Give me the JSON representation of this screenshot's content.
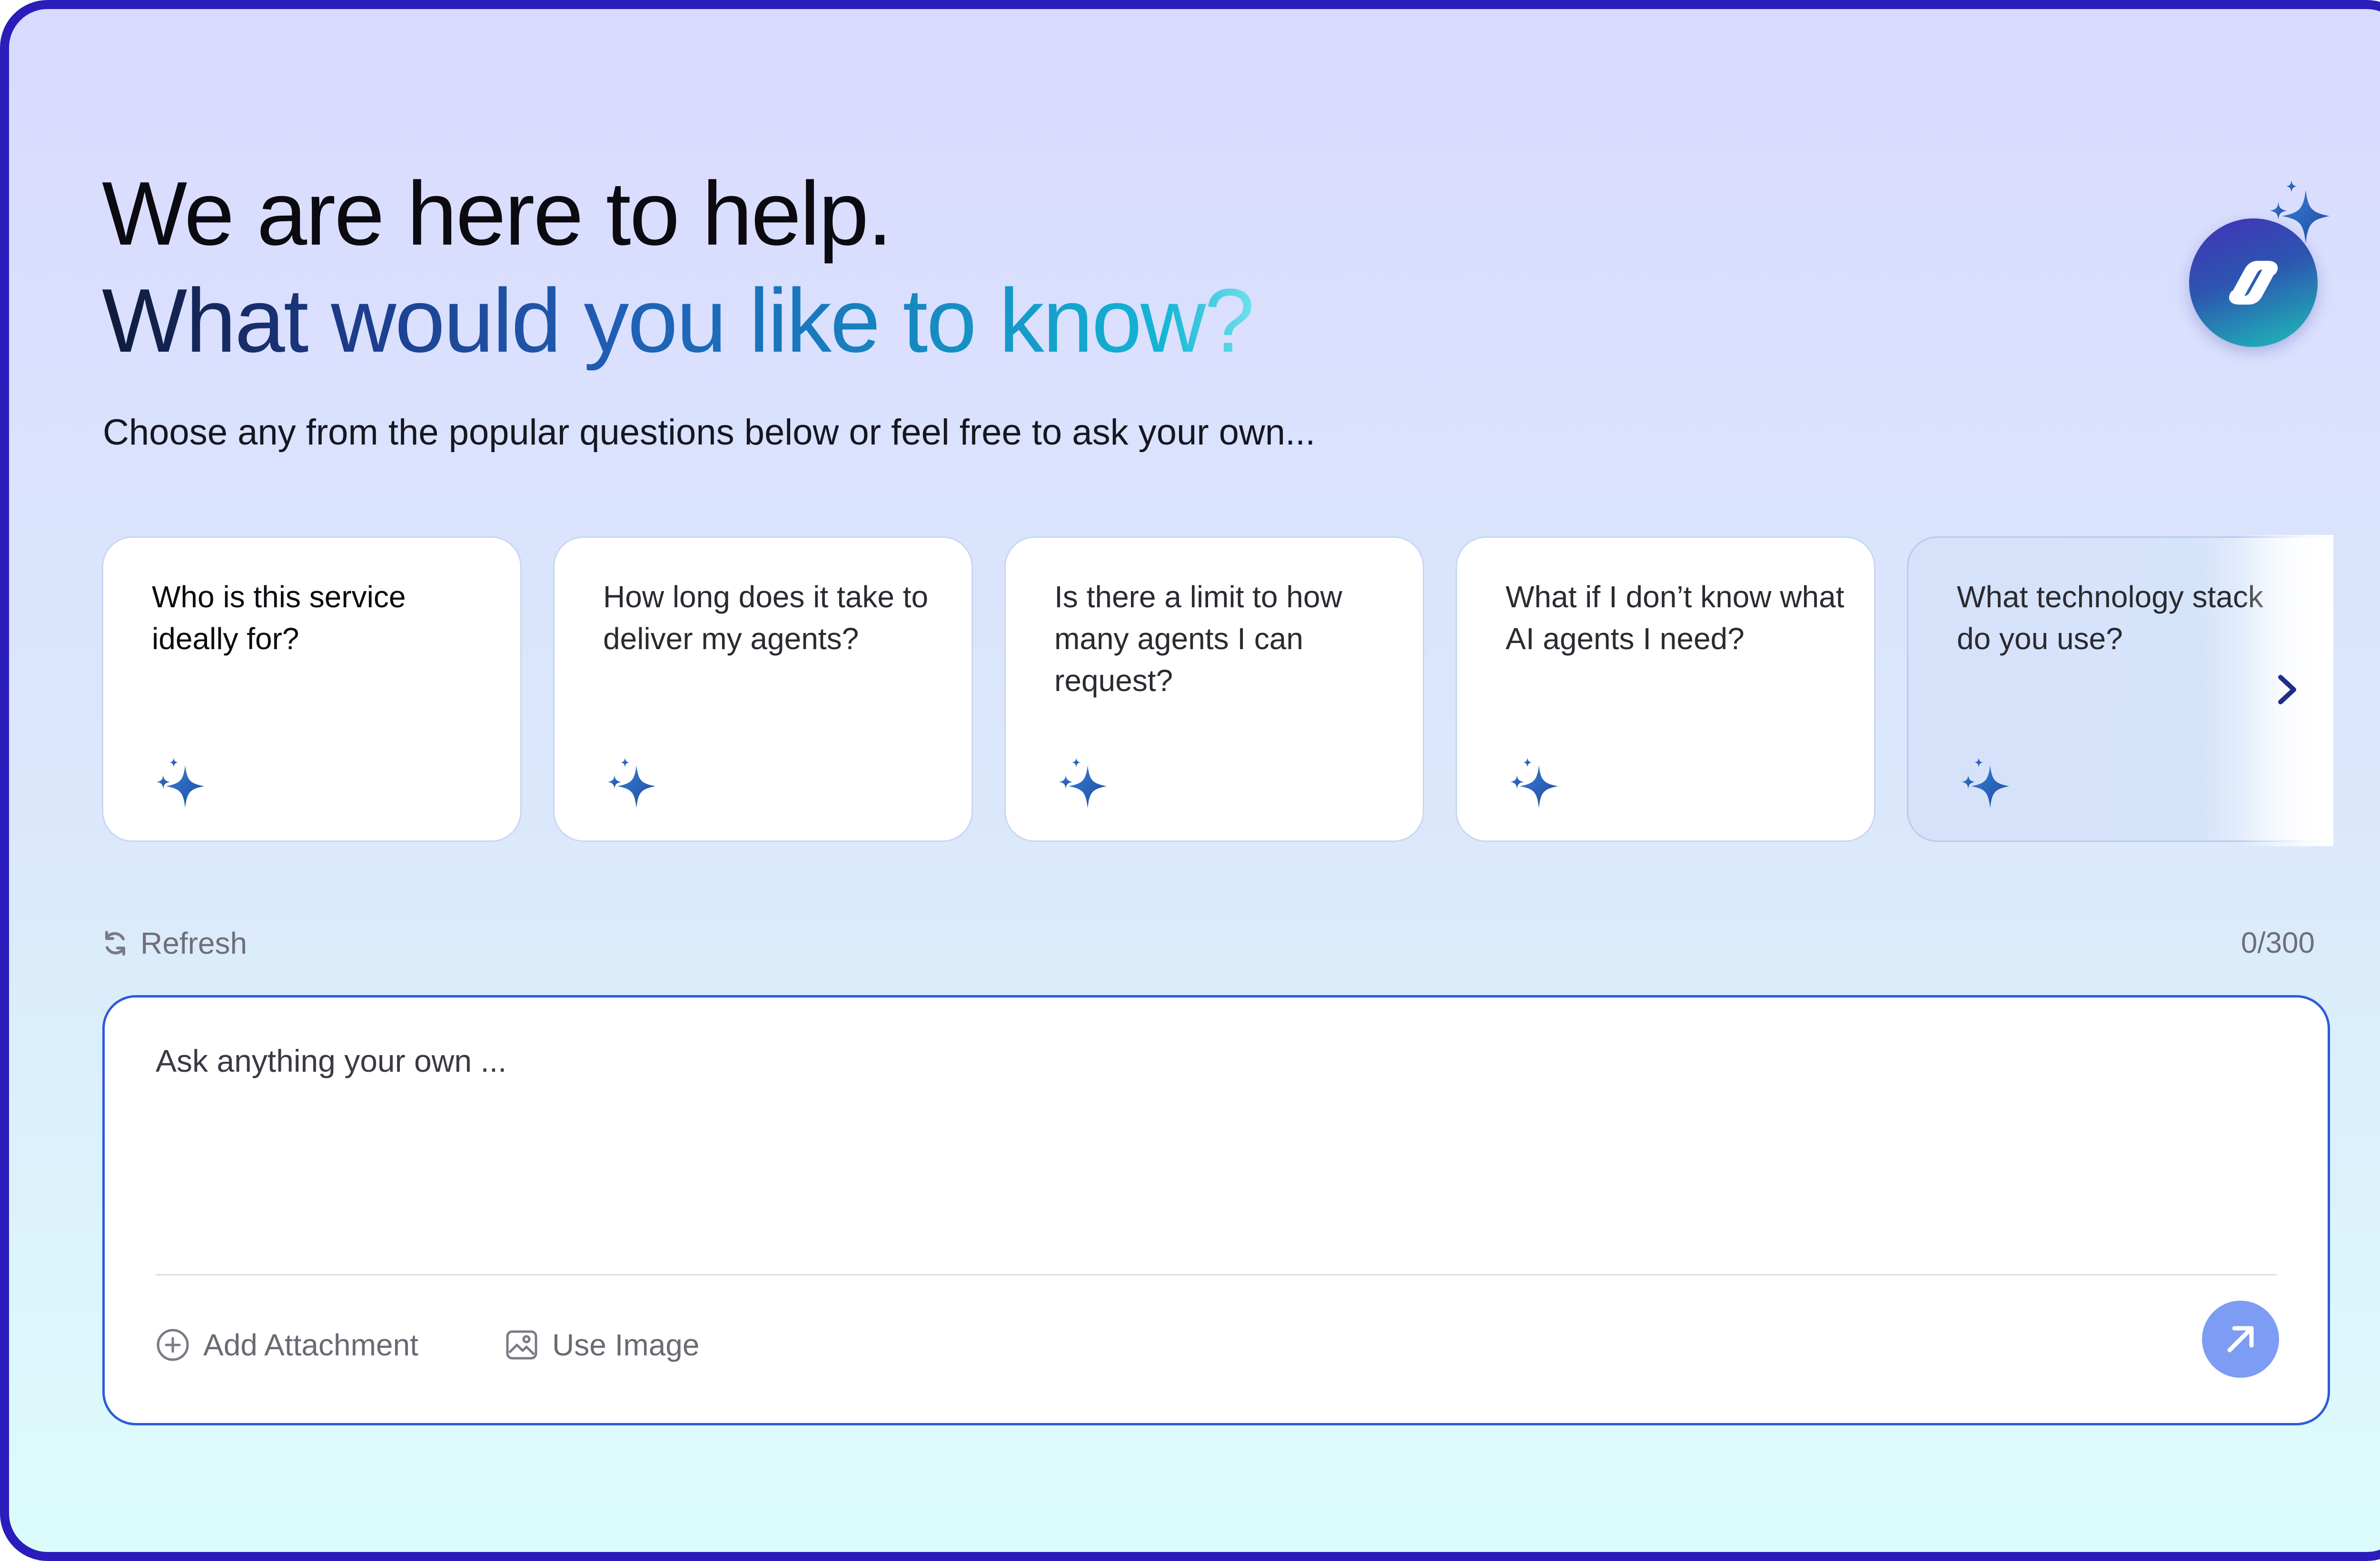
{
  "header": {
    "line1": "We are here to help.",
    "line2": "What would you like to know?",
    "subtitle": "Choose any from the popular questions below or feel free to ask your own..."
  },
  "suggestions": [
    {
      "text": "Who is this service ideally for?"
    },
    {
      "text": "How long does it take to deliver my agents?"
    },
    {
      "text": "Is there a limit to how many agents I can request?"
    },
    {
      "text": "What if I don’t know what AI agents I need?"
    },
    {
      "text": "What technology stack do you use?"
    }
  ],
  "controls": {
    "refresh_label": "Refresh",
    "char_counter": "0/300"
  },
  "ask": {
    "placeholder": "Ask anything your own ...",
    "add_attachment_label": "Add Attachment",
    "use_image_label": "Use Image"
  },
  "colors": {
    "frame_border": "#2b1cbc",
    "accent_blue": "#2d5bd8",
    "send_button": "#7d9cf3",
    "sparkle": "#2a6fc4"
  },
  "icons": {
    "logo": "link-logo-icon",
    "card": "sparkle-icon",
    "refresh": "refresh-icon",
    "attachment": "plus-circle-icon",
    "image": "image-icon",
    "send": "arrow-up-right-icon",
    "next": "chevron-right-icon"
  }
}
